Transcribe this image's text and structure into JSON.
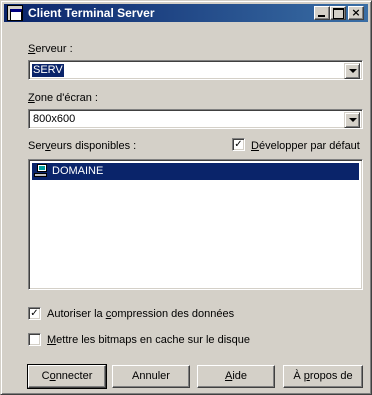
{
  "window": {
    "title": "Client Terminal Server",
    "controls": {
      "close_glyph": "×"
    }
  },
  "server": {
    "label_prefix": "",
    "label_accel": "S",
    "label_rest": "erveur :",
    "value": "SERV"
  },
  "screen_area": {
    "label_prefix": "",
    "label_accel": "Z",
    "label_rest": "one d'écran :",
    "value": "800x600"
  },
  "available_servers": {
    "label_prefix": "Ser",
    "label_accel": "v",
    "label_rest": "eurs disponibles :",
    "expand_default": {
      "checked": true,
      "check_glyph": "✓",
      "label_prefix": "",
      "label_accel": "D",
      "label_rest": "évelopper par défaut"
    },
    "items": [
      {
        "label": "DOMAINE",
        "icon": "domain-computer-icon",
        "selected": true
      }
    ]
  },
  "options": {
    "compression": {
      "checked": true,
      "check_glyph": "✓",
      "label_prefix": "Autoriser la ",
      "label_accel": "c",
      "label_rest": "ompression des données"
    },
    "bitmap_cache": {
      "checked": false,
      "check_glyph": "",
      "label_prefix": "",
      "label_accel": "M",
      "label_rest": "ettre les bitmaps en cache sur le disque"
    }
  },
  "buttons": {
    "connect": {
      "prefix": "C",
      "accel": "o",
      "rest": "nnecter"
    },
    "cancel": {
      "prefix": "",
      "accel": "",
      "rest": "Annuler"
    },
    "help": {
      "prefix": "",
      "accel": "A",
      "rest": "ide"
    },
    "about": {
      "prefix": "À ",
      "accel": "p",
      "rest": "ropos de"
    }
  },
  "colors": {
    "titlebar_start": "#0a246a",
    "titlebar_end": "#3a6ea5",
    "selection": "#0a246a",
    "face": "#d4d0c8"
  }
}
